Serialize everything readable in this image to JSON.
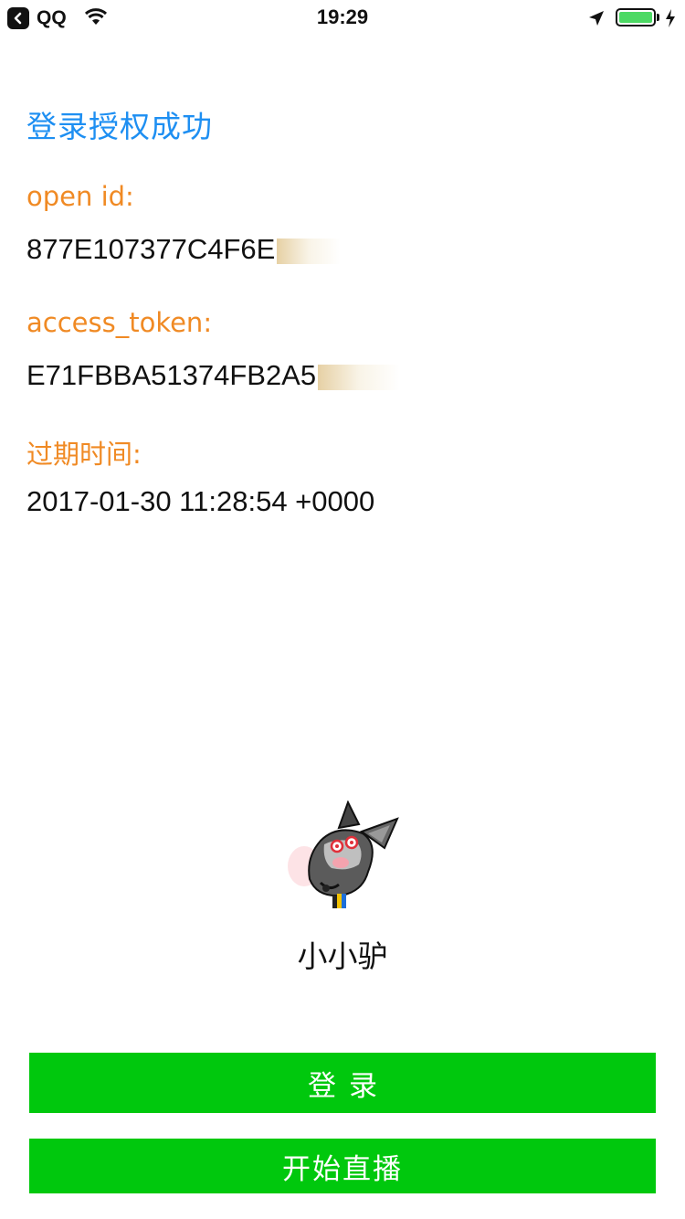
{
  "status_bar": {
    "back_app": "QQ",
    "time": "19:29",
    "icons": [
      "back-arrow-icon",
      "wifi-icon",
      "location-arrow-icon",
      "battery-icon",
      "charging-bolt-icon"
    ],
    "battery_color": "#4cd964"
  },
  "content": {
    "title": "登录授权成功",
    "open_id_label": "open id:",
    "open_id_value": "877E107377C4F6E",
    "access_token_label": "access_token:",
    "access_token_value": "E71FBBA51374FB2A5",
    "expire_label": "过期时间:",
    "expire_value": "2017-01-30 11:28:54 +0000"
  },
  "profile": {
    "nickname": "小小驴"
  },
  "buttons": {
    "login": "登录",
    "start_live": "开始直播",
    "color": "#00c80d"
  },
  "colors": {
    "title": "#1e8ff2",
    "label": "#f08a24"
  }
}
